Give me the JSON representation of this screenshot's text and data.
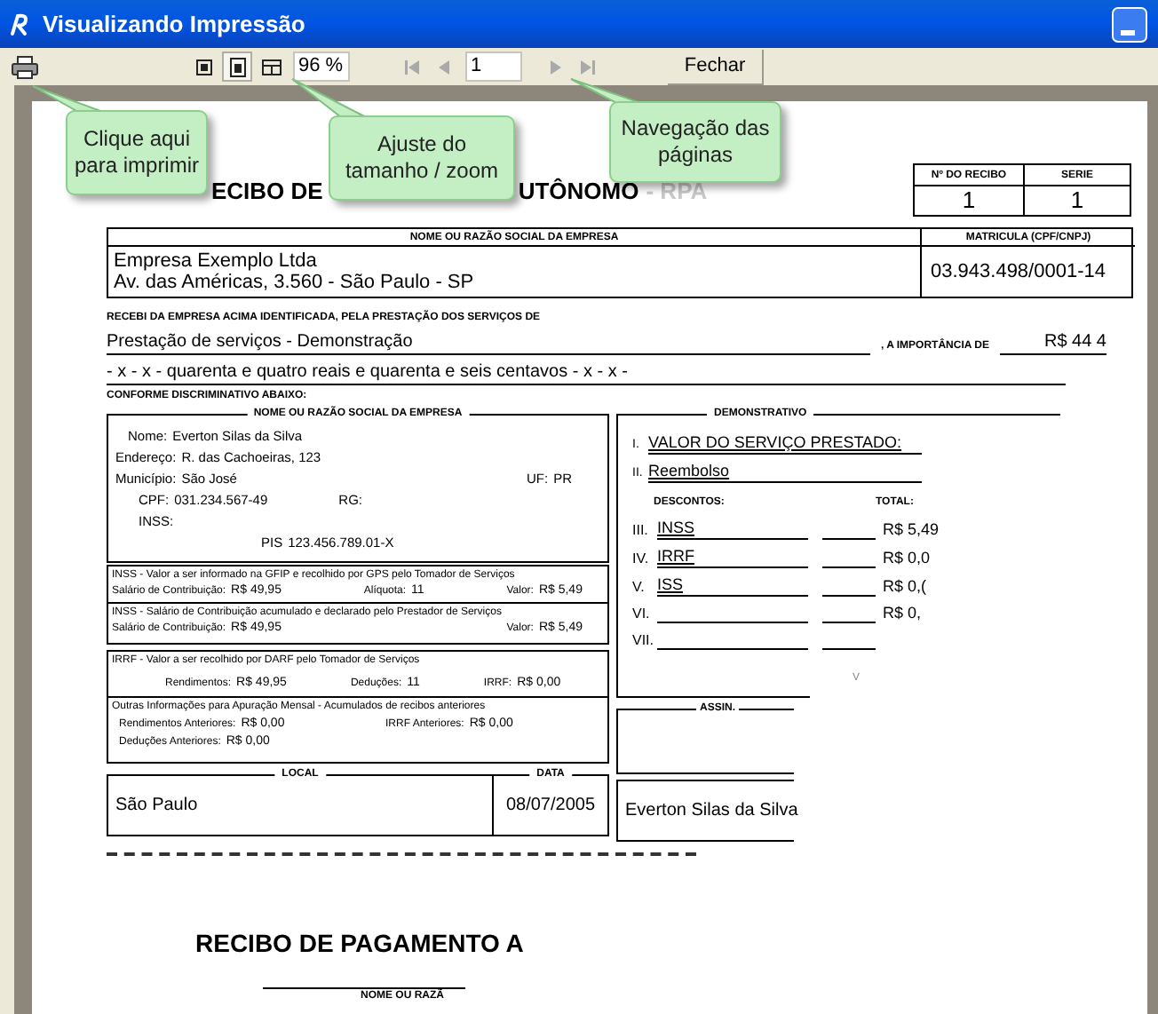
{
  "window": {
    "title": "Visualizando Impressão"
  },
  "toolbar": {
    "zoom_modes": [
      {
        "selected": false
      },
      {
        "selected": true
      },
      {
        "selected": false
      }
    ],
    "zoom": "96 %",
    "page": "1",
    "close_button": "Fechar"
  },
  "callouts": [
    {
      "text": "Clique aqui para imprimir"
    },
    {
      "text": "Ajuste do tamanho / zoom"
    },
    {
      "text": "Navegação das páginas"
    }
  ],
  "document": {
    "title_left": "ECIBO DE",
    "title_right": "UTÔNOMO",
    "title_faded": "- RPA",
    "receipt": {
      "number_label": "Nº DO RECIBO",
      "number": "1",
      "series_label": "SERIE",
      "series": "1"
    },
    "company": {
      "header": "NOME OU RAZÃO SOCIAL DA EMPRESA",
      "id_header": "MATRICULA (CPF/CNPJ)",
      "name": "Empresa Exemplo Ltda",
      "address": "Av. das Américas, 3.560 - São Paulo - SP",
      "id": "03.943.498/0001-14"
    },
    "received_text": "RECEBI DA EMPRESA ACIMA IDENTIFICADA, PELA PRESTAÇÃO DOS SERVIÇOS DE",
    "service": "Prestação de serviços - Demonstração",
    "amount_label": ", A IMPORTÂNCIA DE",
    "amount": "R$ 44 4",
    "amount_words": "- x - x - quarenta e quatro reais e quarenta e seis centavos - x - x -",
    "discrim_label": "CONFORME DISCRIMINATIVO ABAIXO:",
    "provider": {
      "legend": "NOME OU RAZÃO SOCIAL DA EMPRESA",
      "lines": [
        [
          {
            "label": "Nome:",
            "value": "Everton Silas da Silva"
          }
        ],
        [
          {
            "label": "Endereço:",
            "value": "R. das Cachoeiras, 123"
          }
        ],
        [
          {
            "label": "Município:",
            "value": "São José"
          },
          {
            "label": "UF:",
            "value": "PR"
          }
        ],
        [
          {
            "label": "CPF:",
            "value": "031.234.567-49"
          },
          {
            "label": "RG:"
          }
        ],
        [
          {
            "label": "INSS:"
          }
        ],
        [
          {
            "label": "PIS",
            "value": "123.456.789.01-X"
          }
        ]
      ]
    },
    "sections": [
      {
        "title": "INSS - Valor a ser informado na GFIP e recolhido por GPS pelo Tomador de Serviços",
        "items": [
          {
            "label": "Salário de Contribuição:",
            "value": "R$ 49,95"
          },
          {
            "label": "Alíquota:",
            "value": "11"
          },
          {
            "label": "Valor:",
            "value": "R$ 5,49"
          }
        ]
      },
      {
        "title": "INSS - Salário de Contribuição acumulado e declarado pelo Prestador de Serviços",
        "items": [
          {
            "label": "Salário de Contribuição:",
            "value": "R$ 49,95"
          },
          {
            "label": "Valor:",
            "value": "R$ 5,49"
          }
        ]
      },
      {
        "title": "IRRF - Valor a ser recolhido por DARF pelo Tomador de Serviços",
        "items": [
          {
            "label": "Rendimentos:",
            "value": "R$ 49,95"
          },
          {
            "label": "Deduções:",
            "value": "11"
          },
          {
            "label": "IRRF:",
            "value": "R$ 0,00"
          }
        ]
      },
      {
        "title": "Outras Informações para Apuração Mensal - Acumulados de recibos anteriores",
        "items": [
          {
            "label": "Rendimentos Anteriores:",
            "value": "R$ 0,00"
          },
          {
            "label": "IRRF Anteriores:",
            "value": "R$ 0,00"
          },
          {
            "label": "Deduções Anteriores:",
            "value": "R$ 0,00"
          }
        ]
      }
    ],
    "local": {
      "label": "LOCAL",
      "value": "São Paulo"
    },
    "date": {
      "label": "DATA",
      "value": "08/07/2005"
    },
    "statement": {
      "legend": "DEMONSTRATIVO",
      "lines": [
        {
          "num": "I.",
          "label": "VALOR DO SERVIÇO PRESTADO:"
        },
        {
          "num": "II.",
          "label": "Reembolso"
        }
      ],
      "discounts_label": "DESCONTOS:",
      "total_label": "TOTAL:",
      "discounts": [
        {
          "num": "III.",
          "label": "INSS",
          "value": "R$ 5,49"
        },
        {
          "num": "IV.",
          "label": "IRRF",
          "value": "R$ 0,0"
        },
        {
          "num": "V.",
          "label": "ISS",
          "value": "R$ 0,("
        },
        {
          "num": "VI.",
          "value": "R$ 0,"
        },
        {
          "num": "VII."
        }
      ],
      "fragment": "V"
    },
    "signature_label": "ASSIN.",
    "signer": "Everton Silas da Silva",
    "next_title": "RECIBO DE PAGAMENTO A",
    "next_header": "NOME OU RAZÃ"
  }
}
